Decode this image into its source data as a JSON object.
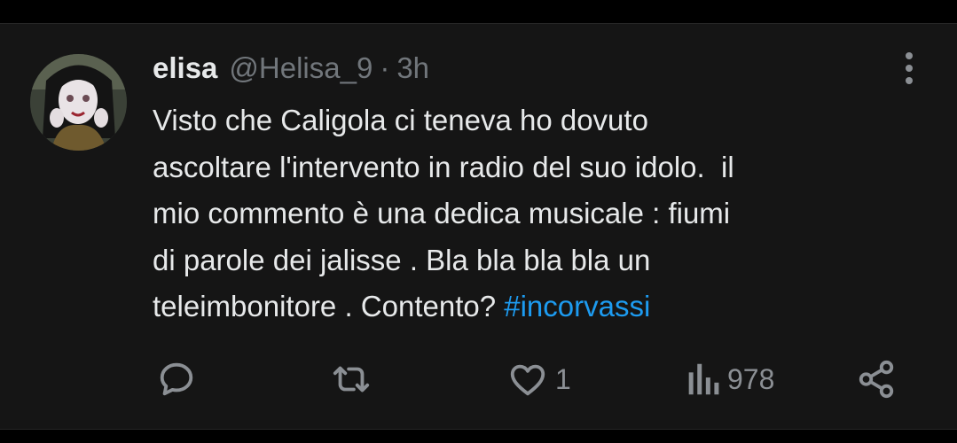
{
  "tweet": {
    "author": {
      "display_name": "elisa",
      "handle": "@Helisa_9",
      "separator": "·",
      "time": "3h"
    },
    "text_lines": [
      "Visto che Caligola ci teneva ho dovuto",
      "ascoltare l'intervento in radio del suo idolo.  il",
      "mio commento è una dedica musicale : fiumi",
      "di parole dei jalisse . Bla bla bla bla un",
      "teleimbonitore . Contento? "
    ],
    "hashtag": "#incorvassi",
    "actions": {
      "reply": {
        "icon": "reply-icon"
      },
      "retweet": {
        "icon": "retweet-icon"
      },
      "like": {
        "icon": "heart-icon",
        "count": "1"
      },
      "views": {
        "icon": "views-icon",
        "count": "978"
      },
      "share": {
        "icon": "share-icon"
      }
    }
  },
  "colors": {
    "background": "#151515",
    "text": "#e7e9ea",
    "muted": "#71767b",
    "link": "#1d9bf0"
  }
}
